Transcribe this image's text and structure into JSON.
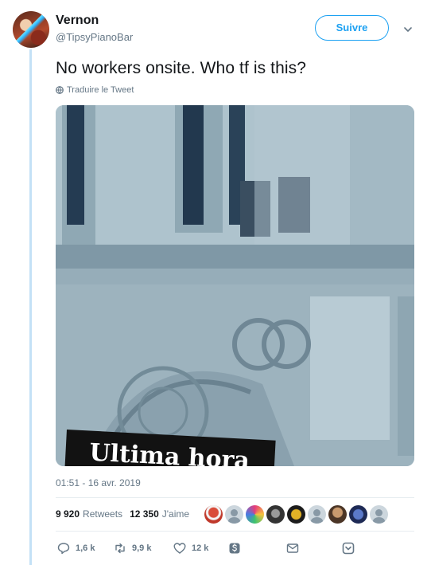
{
  "author": {
    "name": "Vernon",
    "handle": "@TipsyPianoBar"
  },
  "follow_label": "Suivre",
  "tweet": {
    "text": "No workers onsite. Who tf is this?",
    "translate_label": "Traduire le Tweet",
    "timestamp": "01:51 - 16 avr. 2019"
  },
  "media": {
    "banner_text": "Ultima hora"
  },
  "stats": {
    "retweets_count": "9 920",
    "retweets_label": "Retweets",
    "likes_count": "12 350",
    "likes_label": "J'aime"
  },
  "actions": {
    "reply_count": "1,6 k",
    "retweet_count": "9,9 k",
    "like_count": "12 k"
  },
  "colors": {
    "accent": "#1da1f2",
    "thread_line": "#c4e1f6",
    "muted_text": "#657786"
  },
  "icons": {
    "chevron": "chevron-down-icon",
    "globe": "globe-icon",
    "reply": "reply-icon",
    "retweet": "retweet-icon",
    "like": "heart-icon",
    "dollar": "dollar-icon",
    "message": "envelope-icon",
    "share": "share-icon"
  }
}
